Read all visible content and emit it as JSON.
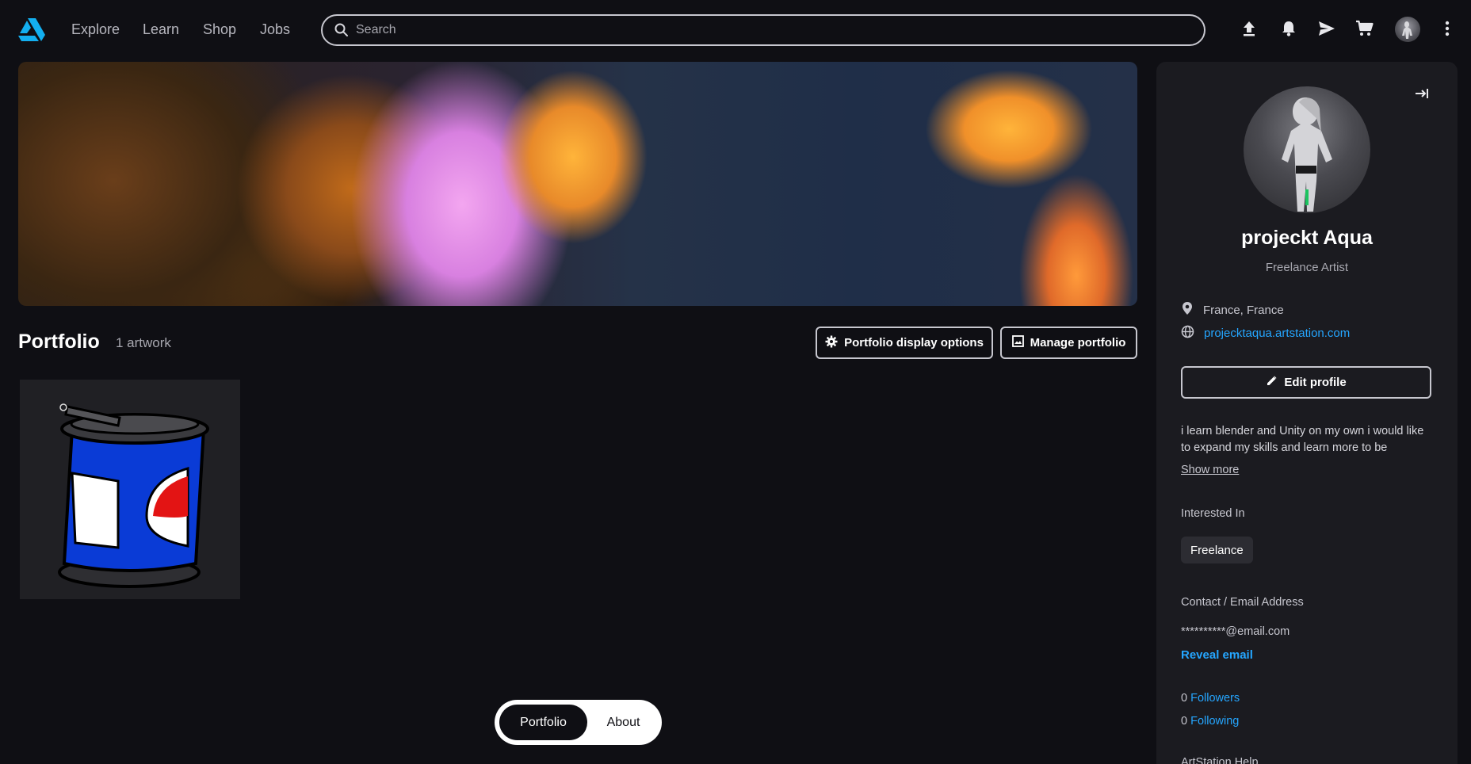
{
  "nav": {
    "links": [
      "Explore",
      "Learn",
      "Shop",
      "Jobs"
    ],
    "search_placeholder": "Search"
  },
  "icons": {
    "logo": "artstation-logo-icon",
    "upload": "upload-icon",
    "notifications": "bell-icon",
    "messages": "send-icon",
    "cart": "cart-icon",
    "more": "more-vertical-icon"
  },
  "colors": {
    "background": "#0f0f14",
    "panel": "#1b1b20",
    "accent": "#13aff0",
    "link": "#25a6ff"
  },
  "portfolio": {
    "title": "Portfolio",
    "count": "1 artwork",
    "display_options_label": "Portfolio display options",
    "manage_label": "Manage portfolio"
  },
  "bottom_tabs": {
    "active": "Portfolio",
    "other": "About"
  },
  "profile": {
    "name": "projeckt Aqua",
    "headline": "Freelance Artist",
    "location": "France, France",
    "website": "projecktaqua.artstation.com",
    "edit_label": "Edit profile",
    "bio": "i learn blender and Unity on my own i would like to expand my skills and learn more to be",
    "show_more": "Show more",
    "interested_label": "Interested In",
    "interested_chip": "Freelance",
    "contact_label": "Contact / Email Address",
    "email_masked": "**********@email.com",
    "reveal_email": "Reveal email",
    "followers_count": "0",
    "followers_label": "Followers",
    "following_count": "0",
    "following_label": "Following",
    "help_label": "ArtStation Help"
  }
}
